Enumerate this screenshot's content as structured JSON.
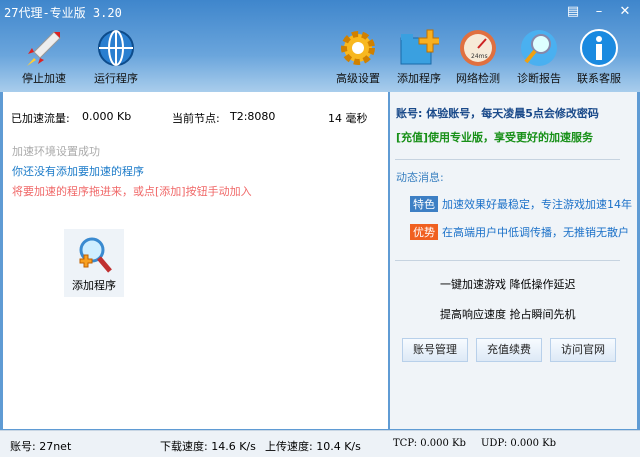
{
  "window": {
    "title": "27代理-专业版 3.20",
    "controls": [
      "skin",
      "minimize",
      "close"
    ]
  },
  "toolbar": {
    "left": [
      {
        "label": "停止加速",
        "icon": "rocket-icon"
      },
      {
        "label": "运行程序",
        "icon": "globe-icon"
      }
    ],
    "right": [
      {
        "label": "高级设置",
        "icon": "gear-icon"
      },
      {
        "label": "添加程序",
        "icon": "folder-add-icon"
      },
      {
        "label": "网络检测",
        "icon": "speedometer-icon",
        "icon_text": "24ms"
      },
      {
        "label": "诊断报告",
        "icon": "magnifier-icon"
      },
      {
        "label": "联系客服",
        "icon": "info-icon"
      }
    ]
  },
  "stats": {
    "traffic_label": "已加速流量:",
    "traffic_value": "0.000 Kb",
    "node_label": "当前节点:",
    "node_value": "T2:8080",
    "latency": "14 毫秒"
  },
  "messages": {
    "status": "加速环境设置成功",
    "no_program": "你还没有添加要加速的程序",
    "hint": "将要加速的程序拖进来，或点[添加]按钮手动加入"
  },
  "add_program": {
    "label": "添加程序"
  },
  "account": {
    "notice": "账号: 体验账号，每天凌晨5点会修改密码",
    "upgrade": "[充值]使用专业版，享受更好的加速服务"
  },
  "news": {
    "heading": "动态消息:",
    "items": [
      {
        "badge": "特色",
        "badge_color": "#3d7fc4",
        "text": "加速效果好最稳定，专注游戏加速14年"
      },
      {
        "badge": "优势",
        "badge_color": "#f06020",
        "text": "在高端用户中低调传播，无推销无散户"
      }
    ]
  },
  "slogans": [
    "一键加速游戏 降低操作延迟",
    "提高响应速度 抢占瞬间先机"
  ],
  "buttons": {
    "account": "账号管理",
    "recharge": "充值续费",
    "website": "访问官网"
  },
  "status": {
    "account": "账号: 27net",
    "download": "下载速度: 14.6 K/s",
    "upload": "上传速度: 10.4 K/s",
    "tcp": "TCP: 0.000 Kb",
    "udp": "UDP: 0.000 Kb"
  }
}
